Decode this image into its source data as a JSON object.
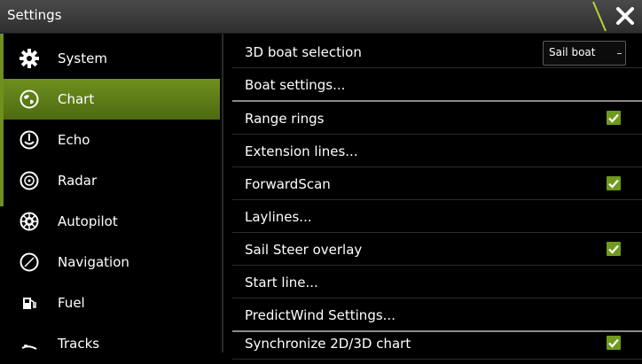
{
  "header": {
    "title": "Settings"
  },
  "sidebar": {
    "items": [
      {
        "label": "System",
        "icon": "gear-icon"
      },
      {
        "label": "Chart",
        "icon": "globe-icon",
        "active": true
      },
      {
        "label": "Echo",
        "icon": "echo-icon"
      },
      {
        "label": "Radar",
        "icon": "radar-icon"
      },
      {
        "label": "Autopilot",
        "icon": "autopilot-wheel-icon"
      },
      {
        "label": "Navigation",
        "icon": "compass-icon"
      },
      {
        "label": "Fuel",
        "icon": "fuel-pump-icon"
      },
      {
        "label": "Tracks",
        "icon": "tracks-icon"
      }
    ]
  },
  "settings": {
    "rows": [
      {
        "label": "3D boat selection",
        "dropdown": "Sail boat"
      },
      {
        "label": "Boat settings..."
      },
      {
        "label": "Range rings",
        "checked": true
      },
      {
        "label": "Extension lines..."
      },
      {
        "label": "ForwardScan",
        "checked": true
      },
      {
        "label": "Laylines..."
      },
      {
        "label": "Sail Steer overlay",
        "checked": true
      },
      {
        "label": "Start line..."
      },
      {
        "label": "PredictWind Settings..."
      },
      {
        "label": "Synchronize 2D/3D chart",
        "checked": true
      }
    ]
  },
  "colors": {
    "accent": "#6f8f1e",
    "check": "#6f9a1e",
    "background": "#000000"
  }
}
